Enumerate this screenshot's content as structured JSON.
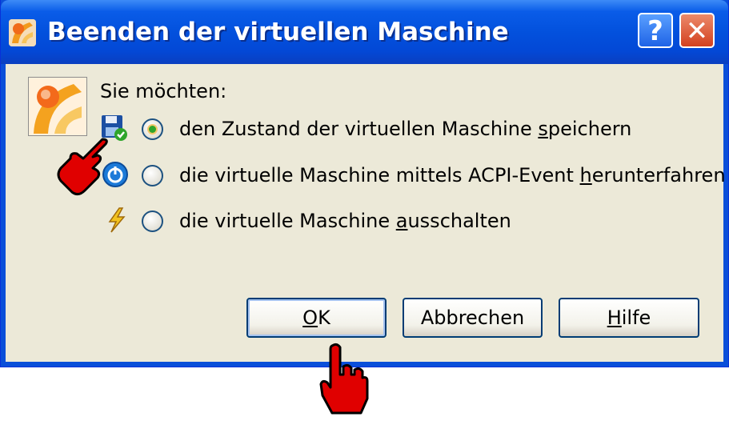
{
  "window": {
    "title": "Beenden der virtuellen Maschine",
    "help_glyph": "?",
    "close_glyph": "✕"
  },
  "dialog": {
    "prompt": "Sie möchten:",
    "options": [
      {
        "pre": "den Zustand der virtuellen Maschine ",
        "hot": "s",
        "post": "peichern",
        "icon": "floppy-save-icon",
        "selected": true
      },
      {
        "pre": "die virtuelle Maschine mittels ACPI-Event ",
        "hot": "h",
        "post": "erunterfahren",
        "icon": "power-acpi-icon",
        "selected": false
      },
      {
        "pre": "die virtuelle Maschine ",
        "hot": "a",
        "post": "usschalten",
        "icon": "lightning-icon",
        "selected": false
      }
    ]
  },
  "buttons": {
    "ok": {
      "hot": "O",
      "rest": "K"
    },
    "cancel": {
      "label": "Abbrechen"
    },
    "help": {
      "hot": "H",
      "rest": "ilfe"
    }
  },
  "colors": {
    "titlebar": "#0351dd",
    "client": "#ece9d8",
    "close_button": "#d3411f",
    "pointer_hand": "#e00000"
  }
}
